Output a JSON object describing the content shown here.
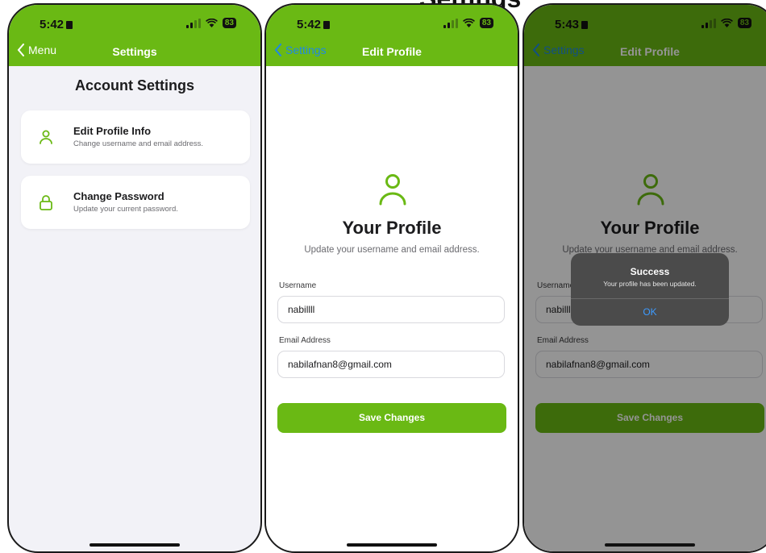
{
  "page_title": "Settings",
  "screen1": {
    "time": "5:42",
    "battery": "83",
    "back_label": "Menu",
    "nav_title": "Settings",
    "heading": "Account Settings",
    "items": [
      {
        "title": "Edit Profile Info",
        "subtitle": "Change username and email address.",
        "icon": "user-icon"
      },
      {
        "title": "Change Password",
        "subtitle": "Update your current password.",
        "icon": "lock-icon"
      }
    ]
  },
  "screen2": {
    "time": "5:42",
    "battery": "83",
    "back_label": "Settings",
    "nav_title": "Edit Profile",
    "heading": "Your Profile",
    "subheading": "Update your username and email address.",
    "username_label": "Username",
    "username_value": "nabillll",
    "email_label": "Email Address",
    "email_value": "nabilafnan8@gmail.com",
    "save_label": "Save Changes"
  },
  "screen3": {
    "time": "5:43",
    "battery": "83",
    "back_label": "Settings",
    "nav_title": "Edit Profile",
    "heading": "Your Profile",
    "subheading": "Update your username and email address.",
    "username_label": "Username",
    "username_value": "nabillll",
    "email_label": "Email Address",
    "email_value": "nabilafnan8@gmail.com",
    "save_label": "Save Changes",
    "alert": {
      "title": "Success",
      "message": "Your profile has been updated.",
      "ok_label": "OK"
    }
  },
  "colors": {
    "accent": "#6ab914",
    "link_blue": "#1e88e5",
    "alert_bg": "#4b4b4b"
  }
}
